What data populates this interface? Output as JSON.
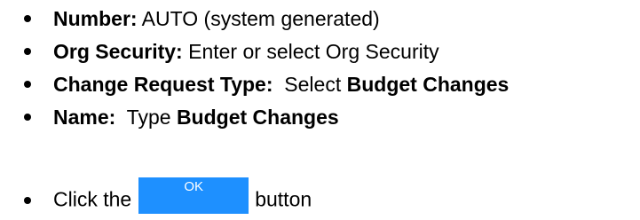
{
  "items": [
    {
      "label": "Number:",
      "text": " AUTO (system generated)"
    },
    {
      "label": "Org Security:",
      "text": " Enter or select Org Security"
    },
    {
      "label": "Change Request Type:",
      "text": "  Select ",
      "value": "Budget Changes"
    },
    {
      "label": "Name:",
      "text": "  Type ",
      "value": "Budget Changes"
    }
  ],
  "click": {
    "prefix": "Click the",
    "button_label": "OK",
    "suffix": "button"
  }
}
